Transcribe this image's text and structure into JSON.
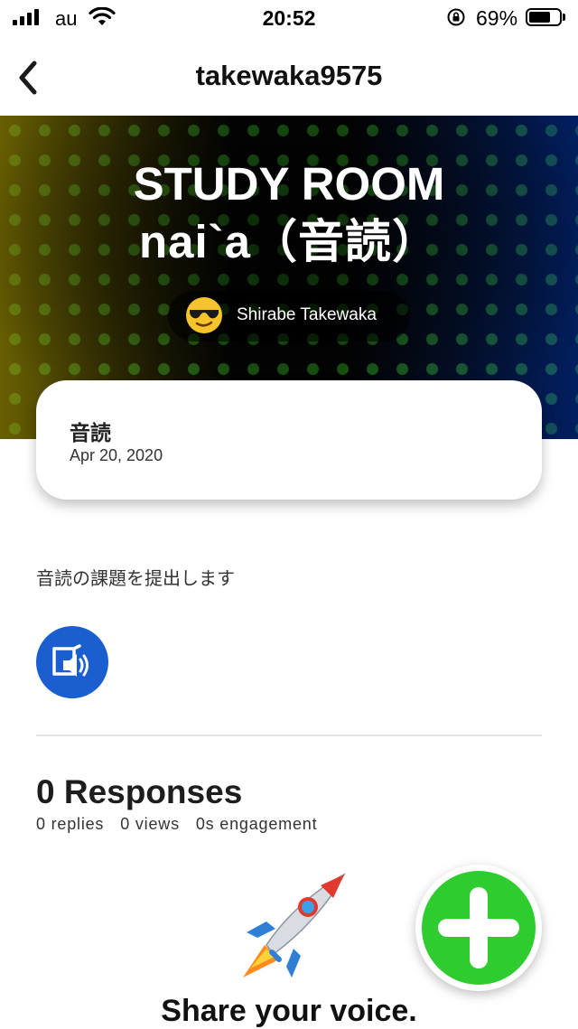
{
  "status_bar": {
    "carrier": "au",
    "time": "20:52",
    "battery_percent": "69%",
    "battery_level": 0.69
  },
  "nav": {
    "title": "takewaka9575",
    "back_icon": "chevron-left-icon"
  },
  "hero": {
    "title_line1": "STUDY ROOM",
    "title_line2": "nai`a（音読）",
    "author_name": "Shirabe Takewaka",
    "author_icon": "sunglasses-emoji-icon"
  },
  "card": {
    "title": "音読",
    "date": "Apr 20, 2020"
  },
  "description": "音読の課題を提出します",
  "audio_button_icon": "book-speaker-icon",
  "responses": {
    "title": "0 Responses",
    "replies": "0 replies",
    "views": "0 views",
    "engagement": "0s engagement"
  },
  "empty_state": {
    "icon": "rocket-icon",
    "text": "Share your voice."
  },
  "fab_icon": "plus-icon",
  "colors": {
    "audio_button": "#1a5ecf",
    "fab": "#2ecc2e"
  }
}
